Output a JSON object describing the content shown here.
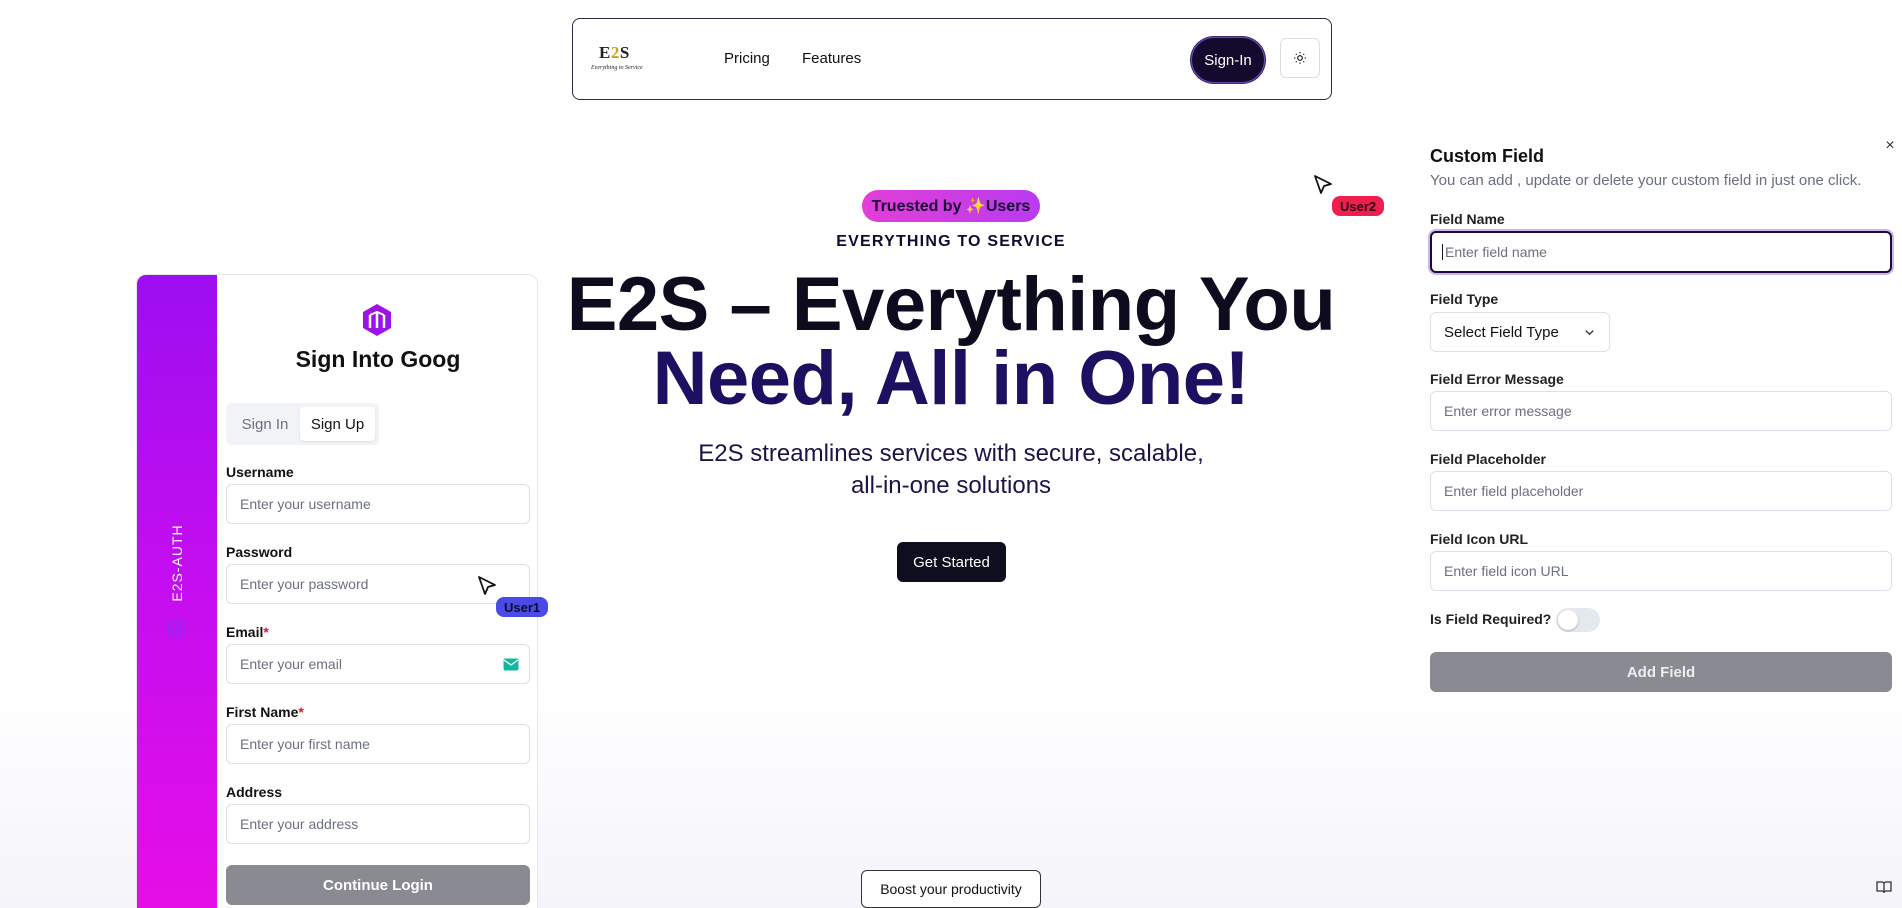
{
  "brand": {
    "logo_main_a": "E",
    "logo_main_b": "2",
    "logo_main_c": "S",
    "logo_tagline": "Everything to Service"
  },
  "nav": {
    "links": [
      "Pricing",
      "Features"
    ],
    "signin_label": "Sign-In",
    "theme_icon": "sun-icon"
  },
  "hero": {
    "badge": "Truested by ✨Users",
    "eyebrow": "EVERYTHING TO SERVICE",
    "title_line1": "E2S – Everything You",
    "title_line2": "Need, All in One!",
    "subtitle_line1": "E2S streamlines services with secure, scalable,",
    "subtitle_line2": "all-in-one solutions",
    "cta": "Get Started",
    "boost": "Boost your productivity"
  },
  "auth_card": {
    "strip_text": "E2S-AUTH",
    "title": "Sign Into Goog",
    "tabs": [
      "Sign In",
      "Sign Up"
    ],
    "active_tab": "Sign Up",
    "fields": {
      "username": {
        "label": "Username",
        "placeholder": "Enter your username"
      },
      "password": {
        "label": "Password",
        "placeholder": "Enter your password"
      },
      "email": {
        "label": "Email",
        "required_mark": "*",
        "placeholder": "Enter your email"
      },
      "first_name": {
        "label": "First Name",
        "required_mark": "*",
        "placeholder": "Enter your first name"
      },
      "address": {
        "label": "Address",
        "placeholder": "Enter your address"
      }
    },
    "submit": "Continue Login",
    "colors": {
      "strip_top": "#9d0ef0",
      "strip_bottom": "#e80ee6"
    }
  },
  "cursors": {
    "user1": "User1",
    "user2": "User2"
  },
  "custom_field": {
    "close_glyph": "×",
    "title": "Custom Field",
    "description": "You can add , update or delete your custom field in just one click.",
    "field_name": {
      "label": "Field Name",
      "placeholder": "Enter field name"
    },
    "field_type": {
      "label": "Field Type",
      "value": "Select Field Type"
    },
    "error_message": {
      "label": "Field Error Message",
      "placeholder": "Enter error message"
    },
    "placeholder": {
      "label": "Field Placeholder",
      "placeholder": "Enter field placeholder"
    },
    "icon_url": {
      "label": "Field Icon URL",
      "placeholder": "Enter field icon URL"
    },
    "required_toggle": {
      "label": "Is Field Required?",
      "on": false
    },
    "submit": "Add Field"
  }
}
